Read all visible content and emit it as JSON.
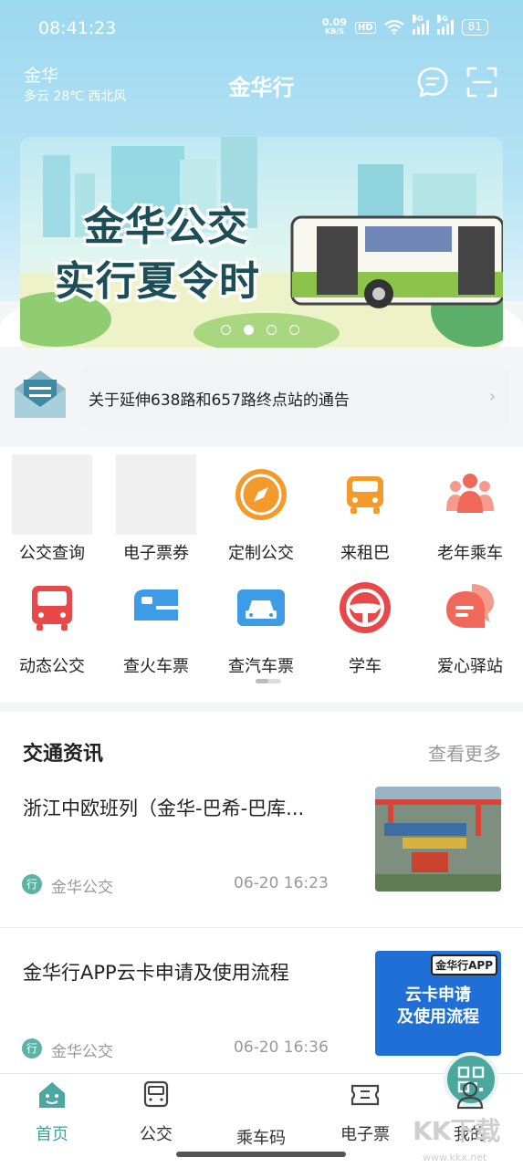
{
  "status_bar": {
    "time": "08:41:23",
    "net_speed_value": "0.09",
    "net_speed_unit": "KB/S",
    "hd_label": "HD",
    "signal_label": "5G",
    "battery": "81"
  },
  "header": {
    "city": "金华",
    "weather": "多云 28℃ 西北风",
    "title": "金华行"
  },
  "banner": {
    "line1": "金华公交",
    "line2": "实行夏令时",
    "slide_count": 4,
    "active_slide": 2
  },
  "notice": {
    "text": "关于延伸638路和657路终点站的通告"
  },
  "services": [
    {
      "label": "公交查询",
      "icon": "placeholder"
    },
    {
      "label": "电子票券",
      "icon": "placeholder"
    },
    {
      "label": "定制公交",
      "icon": "compass-icon",
      "color": "#f39a2b"
    },
    {
      "label": "来租巴",
      "icon": "car-icon",
      "color": "#f39a2b"
    },
    {
      "label": "老年乘车",
      "icon": "people-icon",
      "color": "#f0685a"
    },
    {
      "label": "动态公交",
      "icon": "bus-icon",
      "color": "#e9484b"
    },
    {
      "label": "查火车票",
      "icon": "train-icon",
      "color": "#3e9be6"
    },
    {
      "label": "查汽车票",
      "icon": "taxi-ticket-icon",
      "color": "#3e9be6"
    },
    {
      "label": "学车",
      "icon": "steering-wheel-icon",
      "color": "#e9484b"
    },
    {
      "label": "爱心驿站",
      "icon": "chat-bubble-icon",
      "color": "#f0685a"
    }
  ],
  "news_section": {
    "title": "交通资讯",
    "more": "查看更多",
    "items": [
      {
        "title": "浙江中欧班列（金华-巴希-巴库...",
        "source_icon": "行",
        "source": "金华公交",
        "time": "06-20 16:23"
      },
      {
        "title": "金华行APP云卡申请及使用流程",
        "source_icon": "行",
        "source": "金华公交",
        "time": "06-20 16:36",
        "thumb_tag": "金华行APP",
        "thumb_line1": "云卡申请",
        "thumb_line2": "及使用流程"
      }
    ]
  },
  "tabbar": {
    "tabs": [
      {
        "label": "首页",
        "icon": "home-icon"
      },
      {
        "label": "公交",
        "icon": "bus-icon"
      },
      {
        "label": "乘车码",
        "icon": "qr-code-icon"
      },
      {
        "label": "电子票",
        "icon": "ticket-icon"
      },
      {
        "label": "我的",
        "icon": "user-icon"
      }
    ],
    "active": 0
  },
  "watermark": {
    "text": "KK下载",
    "url": "www.kkx.net"
  },
  "colors": {
    "accent": "#3aa79e",
    "sky": "#9cd8ef"
  }
}
